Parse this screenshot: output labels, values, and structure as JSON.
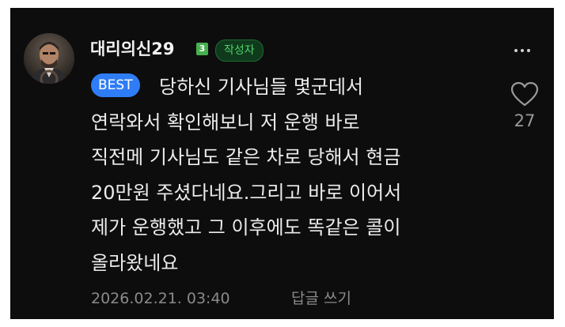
{
  "comment": {
    "username": "대리의신29",
    "level": "3",
    "author_badge": "작성자",
    "best_label": "BEST",
    "body_lines": [
      "당하신 기사님들 몇군데서",
      "연락와서 확인해보니 저 운행 바로",
      "직전메 기사님도 같은 차로 당해서 현금",
      "20만원 주셨다네요.그리고 바로 이어서",
      "제가 운행했고 그 이후에도 똑같은 콜이",
      "올라왔네요"
    ],
    "like_count": "27",
    "timestamp": "2026.02.21. 03:40",
    "reply_label": "답글 쓰기"
  },
  "icons": {
    "more": "more-options-icon",
    "like": "heart-outline-icon"
  },
  "colors": {
    "background": "#0d0d0d",
    "best_badge": "#2f7df6",
    "author_badge_text": "#4fd26a",
    "level_badge": "#46b04e"
  }
}
